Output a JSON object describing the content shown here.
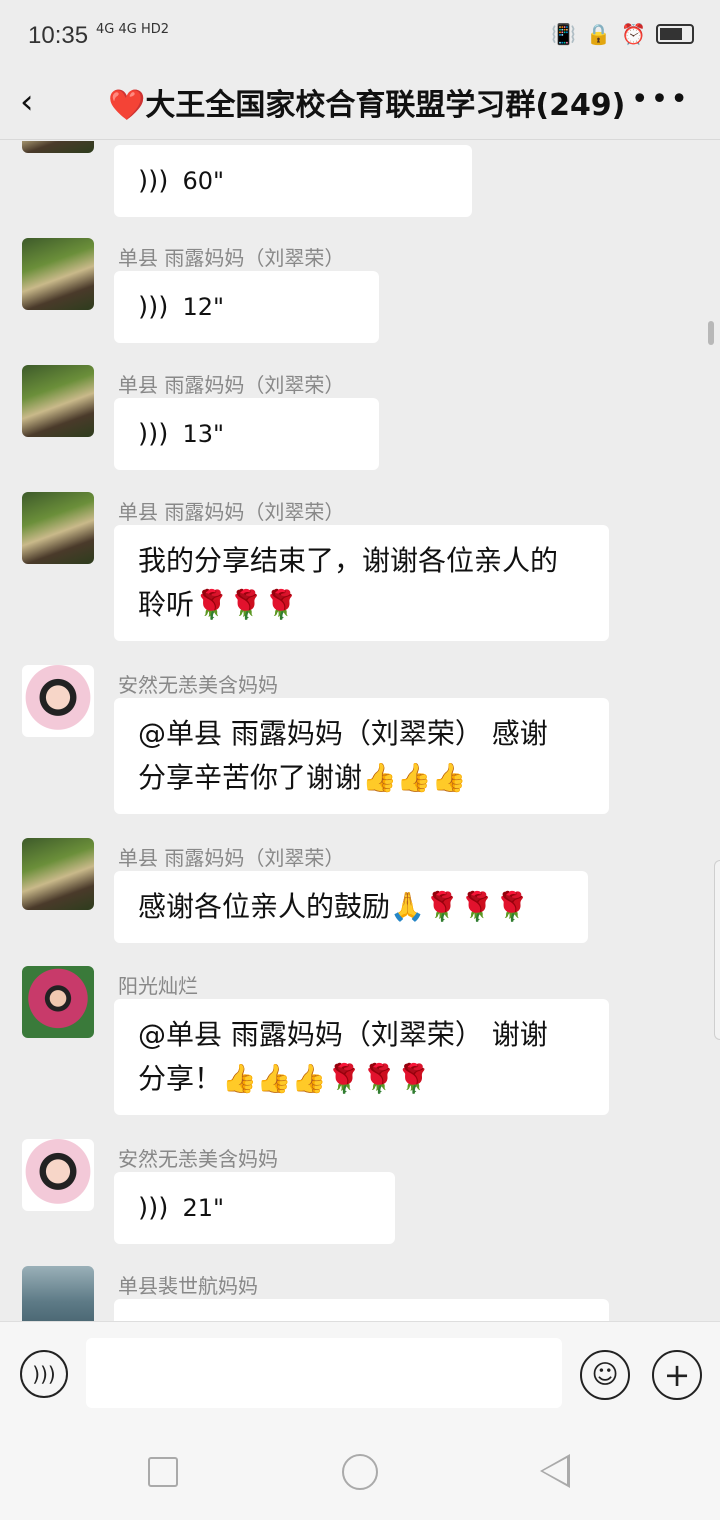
{
  "status_bar": {
    "time": "10:35",
    "network": "4G 4G HD2",
    "icons": [
      "vibrate-icon",
      "lock-rotation-icon",
      "alarm-icon",
      "battery-icon"
    ]
  },
  "header": {
    "back_icon": "chevron-left-icon",
    "title": "❤️大王全国家校合育联盟学习群(249)",
    "more_icon": "more-icon"
  },
  "messages": [
    {
      "sender": "",
      "avatar": "forest",
      "type": "voice",
      "duration": "60\""
    },
    {
      "sender": "单县 雨露妈妈（刘翠荣）",
      "avatar": "forest",
      "type": "voice",
      "duration": "12\""
    },
    {
      "sender": "单县 雨露妈妈（刘翠荣）",
      "avatar": "forest",
      "type": "voice",
      "duration": "13\""
    },
    {
      "sender": "单县 雨露妈妈（刘翠荣）",
      "avatar": "forest",
      "type": "text",
      "text": "我的分享结束了，谢谢各位亲人的\n聆听🌹🌹🌹"
    },
    {
      "sender": "安然无恙美含妈妈",
      "avatar": "girl",
      "type": "text",
      "text": "@单县 雨露妈妈（刘翠荣） 感谢\n分享辛苦你了谢谢👍👍👍"
    },
    {
      "sender": "单县 雨露妈妈（刘翠荣）",
      "avatar": "forest",
      "type": "text",
      "text": "感谢各位亲人的鼓励🙏🌹🌹🌹"
    },
    {
      "sender": "阳光灿烂",
      "avatar": "flower",
      "type": "text",
      "text": "@单县 雨露妈妈（刘翠荣） 谢谢\n分享！👍👍👍🌹🌹🌹"
    },
    {
      "sender": "安然无恙美含妈妈",
      "avatar": "girl",
      "type": "voice",
      "duration": "21\""
    },
    {
      "sender": "单县裴世航妈妈",
      "avatar": "lake",
      "type": "text",
      "text": ""
    }
  ],
  "input_bar": {
    "voice_icon": "voice-input-icon",
    "input_value": "",
    "emoji_icon": "emoji-icon",
    "plus_icon": "plus-icon"
  },
  "nav_bar": {
    "icons": [
      "recent-apps-icon",
      "home-icon",
      "back-icon"
    ]
  }
}
